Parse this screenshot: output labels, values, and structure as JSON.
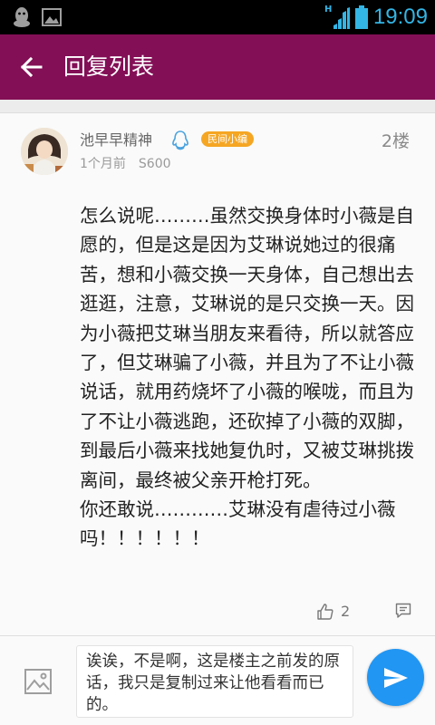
{
  "status_bar": {
    "time": "19:09",
    "signal_label": "H",
    "accent_color": "#33b5e5",
    "icons": [
      "qq-penguin-icon",
      "image-icon",
      "signal-icon",
      "battery-icon"
    ]
  },
  "app_bar": {
    "title": "回复列表",
    "background_color": "#830f56",
    "back_icon": "arrow-left-icon"
  },
  "post": {
    "username": "池早早精神",
    "badge": "民间小编",
    "badge_color": "#f5a623",
    "floor": "2楼",
    "time_ago": "1个月前",
    "device": "S600",
    "content": "怎么说呢………虽然交换身体时小薇是自愿的，但是这是因为艾琳说她过的很痛苦，想和小薇交换一天身体，自己想出去逛逛，注意，艾琳说的是只交换一天。因为小薇把艾琳当朋友来看待，所以就答应了，但艾琳骗了小薇，并且为了不让小薇说话，就用药烧坏了小薇的喉咙，而且为了不让小薇逃跑，还砍掉了小薇的双脚，到最后小薇来找她复仇时，又被艾琳挑拨离间，最终被父亲开枪打死。\n你还敢说…………艾琳没有虐待过小薇吗！！！！！！",
    "like_count": "2"
  },
  "compose": {
    "reply_text": "诶诶，不是啊，这是楼主之前发的原话，我只是复制过来让他看看而已的。",
    "send_color": "#2196f3"
  }
}
